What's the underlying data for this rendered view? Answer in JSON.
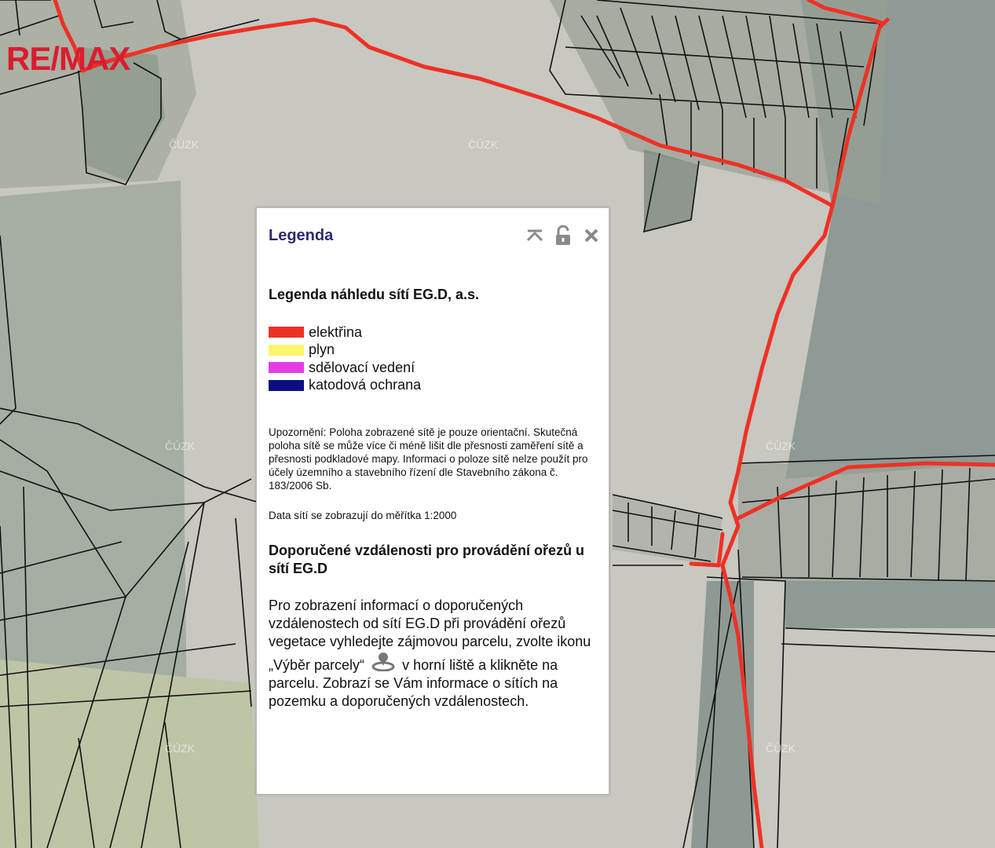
{
  "logo": {
    "text": "RE/MAX"
  },
  "watermark": {
    "text": "ČÚZK"
  },
  "colors": {
    "electricity": "#ee3124",
    "gas": "#fef56c",
    "telecom": "#e33ee6",
    "cathodic": "#0d0f80",
    "title": "#2d2a6e"
  },
  "panel": {
    "title": "Legenda",
    "tools": {
      "collapse_icon": "collapse-up-icon",
      "unlock_icon": "unlock-icon",
      "close_icon": "close-icon"
    },
    "heading": "Legenda náhledu sítí EG.D, a.s.",
    "legend": [
      {
        "label": "elektřina"
      },
      {
        "label": "plyn"
      },
      {
        "label": "sdělovací vedení"
      },
      {
        "label": "katodová ochrana"
      }
    ],
    "note": "Upozornění: Poloha zobrazené sítě je pouze orientační. Skutečná poloha sítě se může více či méně lišit dle přesnosti zaměření sítě a přesnosti podkladové mapy. Informaci o poloze sítě nelze použít pro účely územního a stavebního řízení dle Stavebního zákona č. 183/2006 Sb.",
    "scale_note": "Data sítí se zobrazují do měřítka 1:2000",
    "heading2": "Doporučené vzdálenosti pro provádění ořezů u sítí EG.D",
    "para_part1": "Pro zobrazení informací o doporučených vzdálenostech od sítí EG.D při provádění ořezů vegetace vyhledejte zájmovou parcelu, zvolte ikonu „Výběr parcely“",
    "para_icon": "parcel-select-icon",
    "para_part2": "v horní liště a klikněte na parcelu. Zobrazí se Vám informace o sítích na pozemku a doporučených vzdálenostech."
  }
}
